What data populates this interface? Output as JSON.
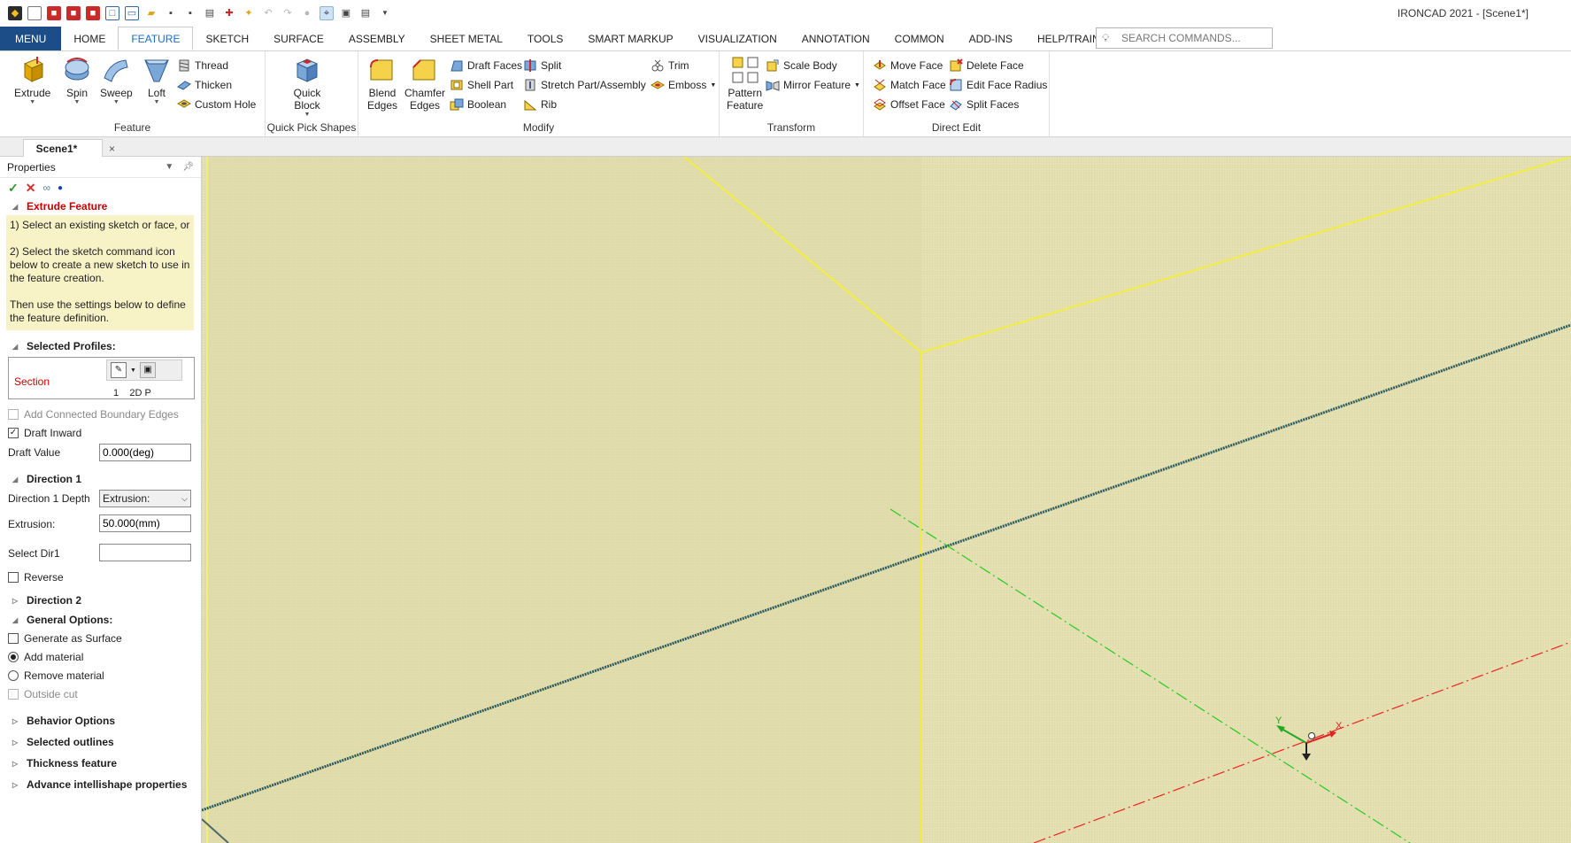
{
  "window": {
    "title": "IRONCAD 2021 - [Scene1*]"
  },
  "ribbon_tabs": [
    "MENU",
    "HOME",
    "FEATURE",
    "SKETCH",
    "SURFACE",
    "ASSEMBLY",
    "SHEET METAL",
    "TOOLS",
    "SMART MARKUP",
    "VISUALIZATION",
    "ANNOTATION",
    "COMMON",
    "ADD-INS",
    "HELP/TRAINING"
  ],
  "search": {
    "placeholder": "SEARCH COMMANDS..."
  },
  "groups": {
    "feature": {
      "label": "Feature",
      "extrude": "Extrude",
      "spin": "Spin",
      "sweep": "Sweep",
      "loft": "Loft",
      "thread": "Thread",
      "thicken": "Thicken",
      "custom_hole": "Custom Hole"
    },
    "quick_pick": {
      "label": "Quick Pick Shapes",
      "quick_block_1": "Quick",
      "quick_block_2": "Block"
    },
    "modify": {
      "label": "Modify",
      "blend_1": "Blend",
      "blend_2": "Edges",
      "chamfer_1": "Chamfer",
      "chamfer_2": "Edges",
      "draft_faces": "Draft Faces",
      "shell_part": "Shell Part",
      "boolean": "Boolean",
      "split": "Split",
      "stretch": "Stretch Part/Assembly",
      "rib": "Rib",
      "trim": "Trim",
      "emboss": "Emboss"
    },
    "transform": {
      "label": "Transform",
      "pattern_1": "Pattern",
      "pattern_2": "Feature",
      "scale_body": "Scale Body",
      "mirror_feature": "Mirror Feature"
    },
    "direct_edit": {
      "label": "Direct Edit",
      "move_face": "Move Face",
      "match_face": "Match Face",
      "offset_face": "Offset Face",
      "delete_face": "Delete Face",
      "edit_face_radius": "Edit Face Radius",
      "split_faces": "Split Faces"
    }
  },
  "doc_tab": {
    "label": "Scene1*",
    "close": "×"
  },
  "properties": {
    "title": "Properties",
    "section_title": "Extrude Feature",
    "help": [
      "1) Select an existing sketch or face, or",
      "2) Select the sketch command icon below to create a new sketch to use in the feature creation.",
      "Then use the settings below to define the feature definition."
    ],
    "selected_profiles": "Selected Profiles:",
    "section_label": "Section",
    "profile_row": "1    2D P",
    "add_connected": "Add Connected Boundary Edges",
    "draft_inward": "Draft Inward",
    "draft_value_label": "Draft Value",
    "draft_value": "0.000(deg)",
    "direction1": "Direction 1",
    "dir1_depth_label": "Direction 1 Depth",
    "dir1_depth_value": "Extrusion:",
    "extrusion_label": "Extrusion:",
    "extrusion_value": "50.000(mm)",
    "select_dir1": "Select Dir1",
    "reverse": "Reverse",
    "direction2": "Direction 2",
    "general_options": "General Options:",
    "generate_surface": "Generate as Surface",
    "add_material": "Add material",
    "remove_material": "Remove material",
    "outside_cut": "Outside cut",
    "behavior_options": "Behavior Options",
    "selected_outlines": "Selected outlines",
    "thickness_feature": "Thickness feature",
    "advance_props": "Advance intellishape properties"
  },
  "viewport": {
    "axis_x": "X",
    "axis_y": "Y"
  },
  "colors": {
    "menu_blue": "#1c4d86",
    "active_tab": "#1c6cc4",
    "viewport_bg": "#e4e0b2",
    "help_bg": "#f8f3c7",
    "section_red": "#cc0000"
  }
}
